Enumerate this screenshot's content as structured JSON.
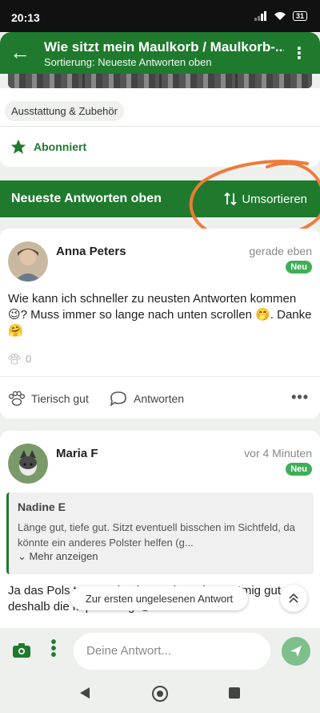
{
  "status_bar": {
    "time": "20:13",
    "battery": "31"
  },
  "header": {
    "title": "Wie sitzt mein Maulkorb / Maulkorb-...",
    "subtitle": "Sortierung: Neueste Antworten oben"
  },
  "topic": {
    "tag": "Ausstattung & Zubehör",
    "subscribed_label": "Abonniert"
  },
  "sort_bar": {
    "label": "Neueste Antworten oben",
    "resort_label": "Umsortieren"
  },
  "posts": [
    {
      "author": "Anna Peters",
      "time": "gerade eben",
      "badge": "Neu",
      "text": "Wie kann ich schneller zu neusten Antworten kommen 😉? Muss immer so lange nach unten scrollen 🤭. Danke 🤗",
      "paw_count": "0",
      "like_label": "Tierisch gut",
      "reply_label": "Antworten"
    },
    {
      "author": "Maria F",
      "time": "vor 4 Minuten",
      "badge": "Neu",
      "quote": {
        "author": "Nadine E",
        "text": "Länge gut, tiefe gut. Sitzt eventuell bisschen im Sichtfeld, da könnte ein anderes Polster helfen (g...",
        "more_label": "Mehr anzeigen"
      },
      "text": "Ja das Pols t zu wechseln . et den Mk so nämig gut deshalb die kopfhaltung 😭"
    }
  ],
  "jump_to_unread": "Zur ersten ungelesenen Antwort",
  "compose": {
    "placeholder": "Deine Antwort..."
  },
  "colors": {
    "primary": "#1f7a2e",
    "badge": "#3fae57",
    "annotation": "#f07a3a"
  }
}
